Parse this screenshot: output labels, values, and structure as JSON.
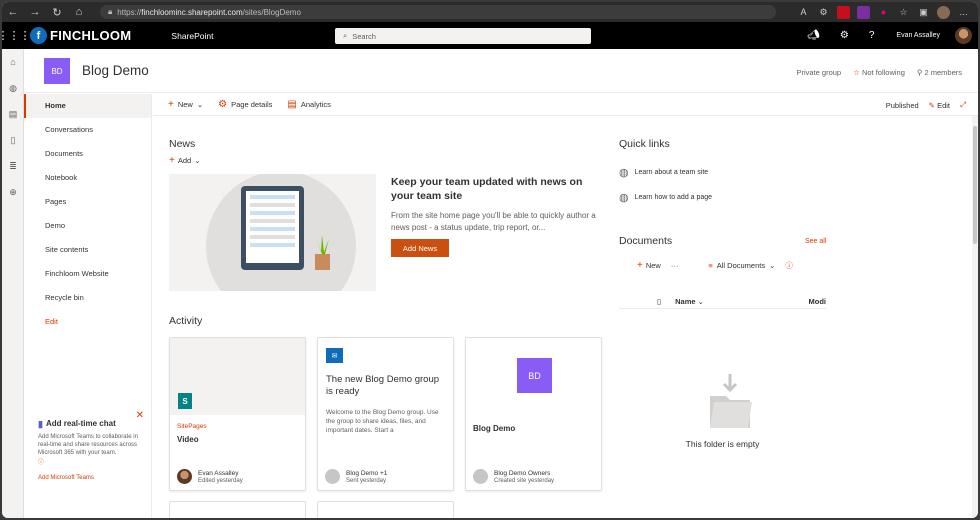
{
  "browser": {
    "url_scheme": "https://",
    "url_host": "finchloominc.sharepoint.com",
    "url_path": "/sites/BlogDemo"
  },
  "suitebar": {
    "brand": "FINCHLOOM",
    "app": "SharePoint",
    "search_placeholder": "Search",
    "user_name": "Evan Assalley"
  },
  "site": {
    "logo_initials": "BD",
    "title": "Blog Demo",
    "privacy": "Private group",
    "follow": "Not following",
    "members": "2 members"
  },
  "nav": {
    "items": [
      "Home",
      "Conversations",
      "Documents",
      "Notebook",
      "Pages",
      "Demo",
      "Site contents",
      "Finchloom Website",
      "Recycle bin"
    ],
    "edit": "Edit"
  },
  "teams_promo": {
    "title": "Add real-time chat",
    "body": "Add Microsoft Teams to collaborate in real-time and share resources across Microsoft 365 with your team.",
    "info": "ⓘ",
    "link": "Add Microsoft Teams"
  },
  "command_bar": {
    "new": "New",
    "page_details": "Page details",
    "analytics": "Analytics",
    "published": "Published",
    "edit": "Edit"
  },
  "news": {
    "heading": "News",
    "add": "Add",
    "headline": "Keep your team updated with news on your team site",
    "body": "From the site home page you'll be able to quickly author a news post - a status update, trip report, or...",
    "button": "Add News"
  },
  "activity": {
    "heading": "Activity",
    "cards": [
      {
        "category": "SitePages",
        "title": "Video",
        "author": "Evan Assalley",
        "meta": "Edited yesterday"
      },
      {
        "title": "The new Blog Demo group is ready",
        "body": "Welcome to the Blog Demo group. Use the group to share ideas, files, and important dates. Start a",
        "author": "Blog Demo +1",
        "meta": "Sent yesterday"
      },
      {
        "logo_initials": "BD",
        "title": "Blog Demo",
        "author": "Blog Demo Owners",
        "meta": "Created site yesterday"
      }
    ]
  },
  "quick_links": {
    "heading": "Quick links",
    "items": [
      "Learn about a team site",
      "Learn how to add a page"
    ]
  },
  "documents": {
    "heading": "Documents",
    "see_all": "See all",
    "new": "New",
    "more": "···",
    "view": "All Documents",
    "col_name": "Name",
    "col_modified": "Modi",
    "empty": "This folder is empty"
  }
}
